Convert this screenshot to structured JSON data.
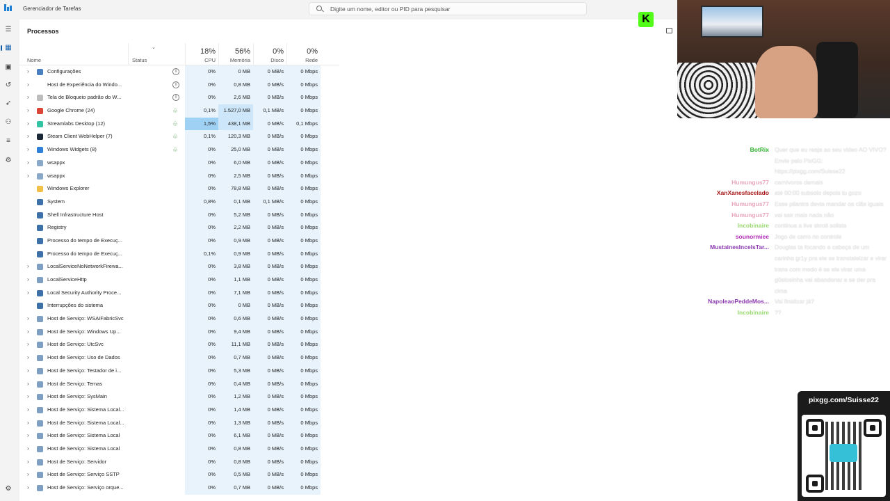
{
  "window": {
    "title": "Gerenciador de Tarefas"
  },
  "search": {
    "placeholder": "Digite um nome, editor ou PID para pesquisar"
  },
  "page": {
    "title": "Processos"
  },
  "columns": {
    "name": "Nome",
    "status": "Status",
    "cpu": {
      "pct": "18%",
      "label": "CPU"
    },
    "memory": {
      "pct": "56%",
      "label": "Memória"
    },
    "disk": {
      "pct": "0%",
      "label": "Disco"
    },
    "network": {
      "pct": "0%",
      "label": "Rede"
    }
  },
  "processes": [
    {
      "expand": true,
      "icon": "gear-icon",
      "icon_color": "#4a7fc1",
      "name": "Configurações",
      "status": "paused",
      "cpu": "0%",
      "mem": "0 MB",
      "disk": "0 MB/s",
      "net": "0 Mbps"
    },
    {
      "expand": true,
      "icon": "blank-icon",
      "icon_color": "#ffffff",
      "name": "Host de Experiência do Windo...",
      "status": "paused",
      "cpu": "0%",
      "mem": "0,8 MB",
      "disk": "0 MB/s",
      "net": "0 Mbps"
    },
    {
      "expand": true,
      "icon": "lock-screen-icon",
      "icon_color": "#bdbdbd",
      "name": "Tela de Bloqueio padrão do W...",
      "status": "paused",
      "cpu": "0%",
      "mem": "2,6 MB",
      "disk": "0 MB/s",
      "net": "0 Mbps"
    },
    {
      "expand": true,
      "icon": "chrome-icon",
      "icon_color": "#db4437",
      "name": "Google Chrome (24)",
      "status": "eco",
      "cpu": "0,1%",
      "mem": "1.527,0 MB",
      "disk": "0,1 MB/s",
      "net": "0 Mbps",
      "mem_hl": "mid"
    },
    {
      "expand": true,
      "icon": "streamlabs-icon",
      "icon_color": "#31c3a2",
      "name": "Streamlabs Desktop (12)",
      "status": "eco",
      "cpu": "1,5%",
      "mem": "438,1 MB",
      "disk": "0 MB/s",
      "net": "0,1 Mbps",
      "cpu_hl": "strong",
      "mem_hl": "mid"
    },
    {
      "expand": true,
      "icon": "steam-icon",
      "icon_color": "#1b2838",
      "name": "Steam Client WebHelper (7)",
      "status": "eco",
      "cpu": "0,1%",
      "mem": "120,3 MB",
      "disk": "0 MB/s",
      "net": "0 Mbps"
    },
    {
      "expand": true,
      "icon": "widgets-icon",
      "icon_color": "#2f7fd8",
      "name": "Windows Widgets (8)",
      "status": "eco",
      "cpu": "0%",
      "mem": "25,0 MB",
      "disk": "0 MB/s",
      "net": "0 Mbps"
    },
    {
      "expand": true,
      "icon": "app-icon",
      "icon_color": "#8aa9c9",
      "name": "wsappx",
      "status": "",
      "cpu": "0%",
      "mem": "6,0 MB",
      "disk": "0 MB/s",
      "net": "0 Mbps"
    },
    {
      "expand": true,
      "icon": "app-icon",
      "icon_color": "#8aa9c9",
      "name": "wsappx",
      "status": "",
      "cpu": "0%",
      "mem": "2,5 MB",
      "disk": "0 MB/s",
      "net": "0 Mbps"
    },
    {
      "expand": false,
      "icon": "folder-icon",
      "icon_color": "#f2c046",
      "name": "Windows Explorer",
      "status": "",
      "cpu": "0%",
      "mem": "78,8 MB",
      "disk": "0 MB/s",
      "net": "0 Mbps"
    },
    {
      "expand": false,
      "icon": "window-icon",
      "icon_color": "#3d6fa8",
      "name": "System",
      "status": "",
      "cpu": "0,8%",
      "mem": "0,1 MB",
      "disk": "0,1 MB/s",
      "net": "0 Mbps"
    },
    {
      "expand": false,
      "icon": "window-icon",
      "icon_color": "#3d6fa8",
      "name": "Shell Infrastructure Host",
      "status": "",
      "cpu": "0%",
      "mem": "5,2 MB",
      "disk": "0 MB/s",
      "net": "0 Mbps"
    },
    {
      "expand": false,
      "icon": "window-icon",
      "icon_color": "#3d6fa8",
      "name": "Registry",
      "status": "",
      "cpu": "0%",
      "mem": "2,2 MB",
      "disk": "0 MB/s",
      "net": "0 Mbps"
    },
    {
      "expand": false,
      "icon": "window-icon",
      "icon_color": "#3d6fa8",
      "name": "Processo do tempo de Execuç...",
      "status": "",
      "cpu": "0%",
      "mem": "0,9 MB",
      "disk": "0 MB/s",
      "net": "0 Mbps"
    },
    {
      "expand": false,
      "icon": "window-icon",
      "icon_color": "#3d6fa8",
      "name": "Processo do tempo de Execuç...",
      "status": "",
      "cpu": "0,1%",
      "mem": "0,9 MB",
      "disk": "0 MB/s",
      "net": "0 Mbps"
    },
    {
      "expand": true,
      "icon": "service-icon",
      "icon_color": "#7f9fc2",
      "name": "LocalServiceNoNetworkFirewa...",
      "status": "",
      "cpu": "0%",
      "mem": "3,8 MB",
      "disk": "0 MB/s",
      "net": "0 Mbps"
    },
    {
      "expand": true,
      "icon": "service-icon",
      "icon_color": "#7f9fc2",
      "name": "LocalServiceHttp",
      "status": "",
      "cpu": "0%",
      "mem": "1,1 MB",
      "disk": "0 MB/s",
      "net": "0 Mbps"
    },
    {
      "expand": true,
      "icon": "window-icon",
      "icon_color": "#3d6fa8",
      "name": "Local Security Authority Proce...",
      "status": "",
      "cpu": "0%",
      "mem": "7,1 MB",
      "disk": "0 MB/s",
      "net": "0 Mbps"
    },
    {
      "expand": false,
      "icon": "window-icon",
      "icon_color": "#3d6fa8",
      "name": "Interrupções do sistema",
      "status": "",
      "cpu": "0%",
      "mem": "0 MB",
      "disk": "0 MB/s",
      "net": "0 Mbps"
    },
    {
      "expand": true,
      "icon": "service-icon",
      "icon_color": "#7f9fc2",
      "name": "Host de Serviço: WSAIFabricSvc",
      "status": "",
      "cpu": "0%",
      "mem": "0,6 MB",
      "disk": "0 MB/s",
      "net": "0 Mbps"
    },
    {
      "expand": true,
      "icon": "service-icon",
      "icon_color": "#7f9fc2",
      "name": "Host de Serviço: Windows Up...",
      "status": "",
      "cpu": "0%",
      "mem": "9,4 MB",
      "disk": "0 MB/s",
      "net": "0 Mbps"
    },
    {
      "expand": true,
      "icon": "service-icon",
      "icon_color": "#7f9fc2",
      "name": "Host de Serviço: UtcSvc",
      "status": "",
      "cpu": "0%",
      "mem": "11,1 MB",
      "disk": "0 MB/s",
      "net": "0 Mbps"
    },
    {
      "expand": true,
      "icon": "service-icon",
      "icon_color": "#7f9fc2",
      "name": "Host de Serviço: Uso de Dados",
      "status": "",
      "cpu": "0%",
      "mem": "0,7 MB",
      "disk": "0 MB/s",
      "net": "0 Mbps"
    },
    {
      "expand": true,
      "icon": "service-icon",
      "icon_color": "#7f9fc2",
      "name": "Host de Serviço: Testador de i...",
      "status": "",
      "cpu": "0%",
      "mem": "5,3 MB",
      "disk": "0 MB/s",
      "net": "0 Mbps"
    },
    {
      "expand": true,
      "icon": "service-icon",
      "icon_color": "#7f9fc2",
      "name": "Host de Serviço: Temas",
      "status": "",
      "cpu": "0%",
      "mem": "0,4 MB",
      "disk": "0 MB/s",
      "net": "0 Mbps"
    },
    {
      "expand": true,
      "icon": "service-icon",
      "icon_color": "#7f9fc2",
      "name": "Host de Serviço: SysMain",
      "status": "",
      "cpu": "0%",
      "mem": "1,2 MB",
      "disk": "0 MB/s",
      "net": "0 Mbps"
    },
    {
      "expand": true,
      "icon": "service-icon",
      "icon_color": "#7f9fc2",
      "name": "Host de Serviço: Sistema Local...",
      "status": "",
      "cpu": "0%",
      "mem": "1,4 MB",
      "disk": "0 MB/s",
      "net": "0 Mbps"
    },
    {
      "expand": true,
      "icon": "service-icon",
      "icon_color": "#7f9fc2",
      "name": "Host de Serviço: Sistema Local...",
      "status": "",
      "cpu": "0%",
      "mem": "1,3 MB",
      "disk": "0 MB/s",
      "net": "0 Mbps"
    },
    {
      "expand": true,
      "icon": "service-icon",
      "icon_color": "#7f9fc2",
      "name": "Host de Serviço: Sistema Local",
      "status": "",
      "cpu": "0%",
      "mem": "6,1 MB",
      "disk": "0 MB/s",
      "net": "0 Mbps"
    },
    {
      "expand": true,
      "icon": "service-icon",
      "icon_color": "#7f9fc2",
      "name": "Host de Serviço: Sistema Local",
      "status": "",
      "cpu": "0%",
      "mem": "0,8 MB",
      "disk": "0 MB/s",
      "net": "0 Mbps"
    },
    {
      "expand": true,
      "icon": "service-icon",
      "icon_color": "#7f9fc2",
      "name": "Host de Serviço: Servidor",
      "status": "",
      "cpu": "0%",
      "mem": "0,8 MB",
      "disk": "0 MB/s",
      "net": "0 Mbps"
    },
    {
      "expand": true,
      "icon": "service-icon",
      "icon_color": "#7f9fc2",
      "name": "Host de Serviço: Serviço SSTP",
      "status": "",
      "cpu": "0%",
      "mem": "0,5 MB",
      "disk": "0 MB/s",
      "net": "0 Mbps"
    },
    {
      "expand": true,
      "icon": "service-icon",
      "icon_color": "#7f9fc2",
      "name": "Host de Serviço: Serviço orque...",
      "status": "",
      "cpu": "0%",
      "mem": "0,7 MB",
      "disk": "0 MB/s",
      "net": "0 Mbps"
    }
  ],
  "chat": [
    {
      "user": "BotRix",
      "color": "u-green",
      "msg": "Quer que eu reaja ao seu video AO VIVO? Envie pelo PixGG: https://pixgg.com/Suisse22"
    },
    {
      "user": "Humungus77",
      "color": "u-pink",
      "msg": "carnívoros demais"
    },
    {
      "user": "XanXanesfacelado",
      "color": "u-red",
      "msg": "até 00:00 subsolo depois tu gozo"
    },
    {
      "user": "Humungus77",
      "color": "u-pink",
      "msg": "Esse pilantra devia mandar os clãs iguais"
    },
    {
      "user": "Humungus77",
      "color": "u-pink",
      "msg": "vai sair mais nada não"
    },
    {
      "user": "Incobinaire",
      "color": "u-lime",
      "msg": "continua a live skroti solista"
    },
    {
      "user": "sounormiee",
      "color": "u-purple",
      "msg": "Jogo de carro no controle"
    },
    {
      "user": "MustainesIncelsTar...",
      "color": "u-violet",
      "msg": "Douglas ta focando a cabeça de um carinha gr1y pra ele se transtaleizar e virar trans com medo é se ele virar uma g0stosinha vai abandonar e se der pra cima"
    },
    {
      "user": "NapoleaoPeddeMos...",
      "color": "u-violet",
      "msg": "Vai finalizar já?"
    },
    {
      "user": "Incobinaire",
      "color": "u-lime",
      "msg": "??"
    }
  ],
  "qr": {
    "url": "pixgg.com/Suisse22"
  },
  "overlay": {
    "k_logo": "K"
  }
}
